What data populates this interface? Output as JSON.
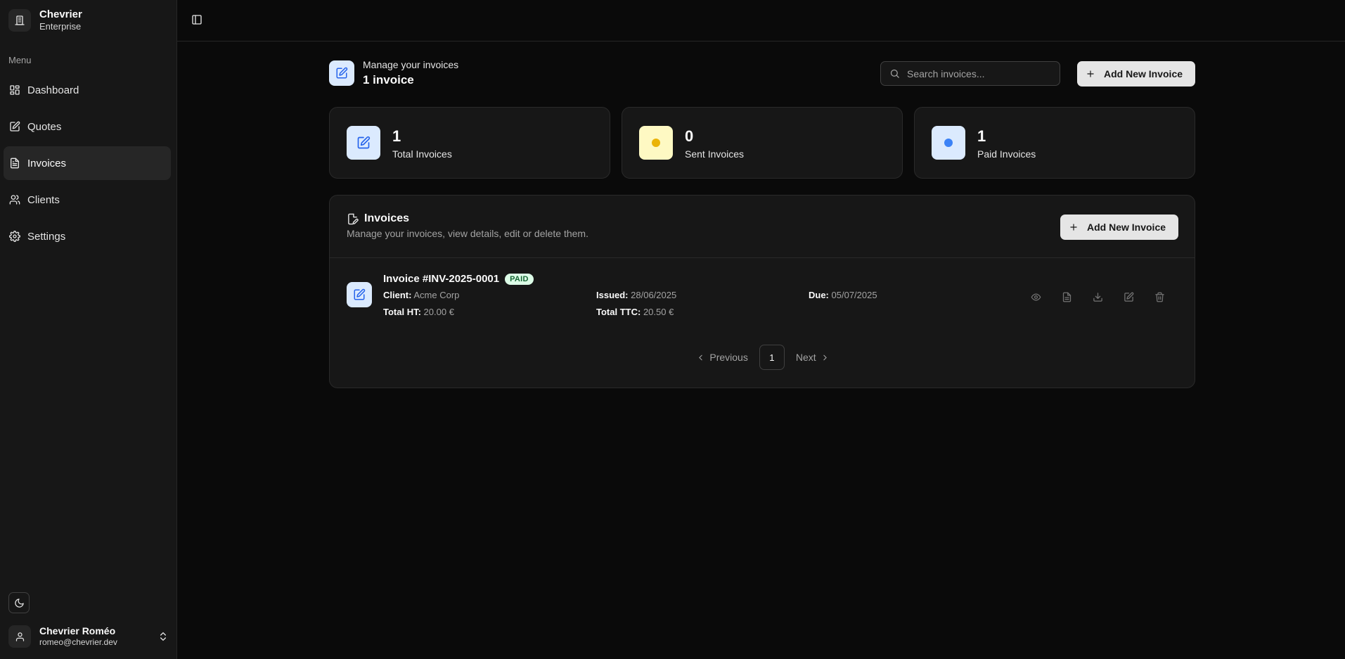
{
  "brand": {
    "name": "Chevrier",
    "subtitle": "Enterprise"
  },
  "sidebar": {
    "menu_label": "Menu",
    "items": [
      {
        "label": "Dashboard",
        "icon": "dashboard-icon"
      },
      {
        "label": "Quotes",
        "icon": "quote-icon"
      },
      {
        "label": "Invoices",
        "icon": "invoice-icon",
        "active": true
      },
      {
        "label": "Clients",
        "icon": "users-icon"
      },
      {
        "label": "Settings",
        "icon": "gear-icon"
      }
    ]
  },
  "user": {
    "name": "Chevrier Roméo",
    "email": "romeo@chevrier.dev"
  },
  "header": {
    "subtitle": "Manage your invoices",
    "count_text": "1 invoice",
    "search_placeholder": "Search invoices...",
    "add_button": "Add New Invoice"
  },
  "stats": [
    {
      "value": "1",
      "label": "Total Invoices"
    },
    {
      "value": "0",
      "label": "Sent Invoices",
      "color": "#eab308"
    },
    {
      "value": "1",
      "label": "Paid Invoices",
      "color": "#3b82f6"
    }
  ],
  "list": {
    "title": "Invoices",
    "description": "Manage your invoices, view details, edit or delete them.",
    "add_button": "Add New Invoice",
    "invoices": [
      {
        "title": "Invoice #INV-2025-0001",
        "status": "PAID",
        "client_label": "Client:",
        "client": "Acme Corp",
        "issued_label": "Issued:",
        "issued": "28/06/2025",
        "due_label": "Due:",
        "due": "05/07/2025",
        "total_ht_label": "Total HT:",
        "total_ht": "20.00 €",
        "total_ttc_label": "Total TTC:",
        "total_ttc": "20.50 €"
      }
    ]
  },
  "pagination": {
    "previous": "Previous",
    "current": "1",
    "next": "Next"
  },
  "colors": {
    "accent_blue": "#2563eb",
    "paid_green": "#166534"
  }
}
